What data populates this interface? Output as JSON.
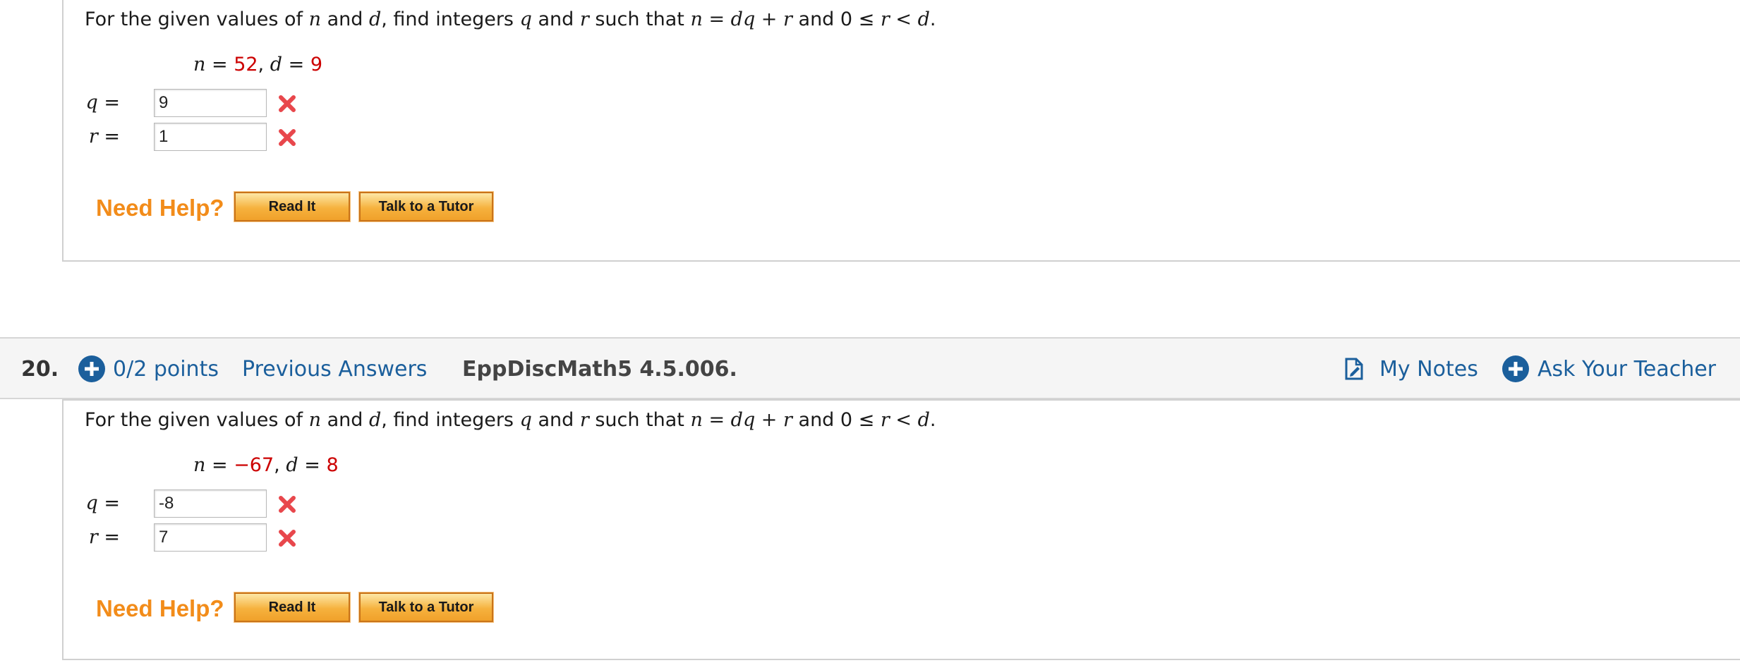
{
  "questions": [
    {
      "prompt_parts": {
        "p1": "For the given values of ",
        "v_n": "n",
        "p2": " and ",
        "v_d": "d",
        "p3": ", find integers ",
        "v_q": "q",
        "p4": " and ",
        "v_r": "r",
        "p5": " such that ",
        "eq1": "n = dq + r",
        "p6": " and 0 ≤ ",
        "eq2": "r < d",
        "p7": "."
      },
      "given": {
        "n_label": "n",
        "eq": " = ",
        "n_value": "52",
        "sep": ", ",
        "d_label": "d",
        "eq2": " = ",
        "d_value": "9"
      },
      "answers": [
        {
          "var": "q",
          "eq": " = ",
          "value": "9",
          "status": "incorrect"
        },
        {
          "var": "r",
          "eq": " = ",
          "value": "1",
          "status": "incorrect"
        }
      ],
      "help": {
        "label": "Need Help?",
        "read_it": "Read It",
        "talk_to_tutor": "Talk to a Tutor"
      }
    },
    {
      "prompt_parts": {
        "p1": "For the given values of ",
        "v_n": "n",
        "p2": " and ",
        "v_d": "d",
        "p3": ", find integers ",
        "v_q": "q",
        "p4": " and ",
        "v_r": "r",
        "p5": " such that ",
        "eq1": "n = dq + r",
        "p6": " and 0 ≤ ",
        "eq2": "r < d",
        "p7": "."
      },
      "given": {
        "n_label": "n",
        "eq": " = ",
        "n_value": "−67",
        "sep": ", ",
        "d_label": "d",
        "eq2": " = ",
        "d_value": "8"
      },
      "answers": [
        {
          "var": "q",
          "eq": " = ",
          "value": "-8",
          "status": "incorrect"
        },
        {
          "var": "r",
          "eq": " = ",
          "value": "7",
          "status": "incorrect"
        }
      ],
      "help": {
        "label": "Need Help?",
        "read_it": "Read It",
        "talk_to_tutor": "Talk to a Tutor"
      }
    }
  ],
  "header": {
    "number": "20.",
    "points": "0/2 points",
    "previous_answers": "Previous Answers",
    "question_id": "EppDiscMath5 4.5.006.",
    "my_notes": "My Notes",
    "ask_teacher": "Ask Your Teacher"
  },
  "icons": {
    "incorrect": "x-mark-icon",
    "points_toggle": "plus-circle-icon",
    "notes": "notes-icon",
    "ask": "plus-circle-icon"
  },
  "colors": {
    "link_blue": "#1b5f9c",
    "help_orange": "#f28c1a",
    "value_red": "#cc0000",
    "incorrect_red": "#e8474c",
    "header_bg": "#f5f5f5"
  }
}
